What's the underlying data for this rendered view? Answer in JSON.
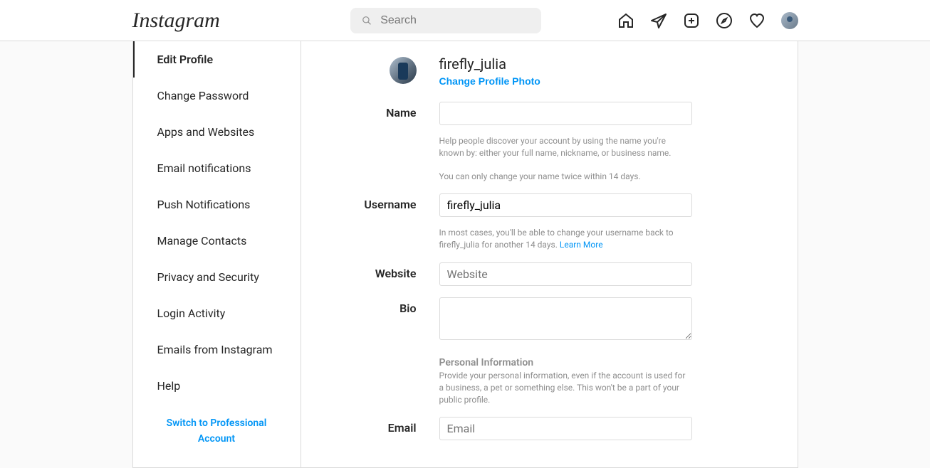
{
  "logo": "Instagram",
  "search": {
    "placeholder": "Search"
  },
  "sidebar": {
    "items": [
      "Edit Profile",
      "Change Password",
      "Apps and Websites",
      "Email notifications",
      "Push Notifications",
      "Manage Contacts",
      "Privacy and Security",
      "Login Activity",
      "Emails from Instagram",
      "Help"
    ],
    "switch": "Switch to Professional Account"
  },
  "profile": {
    "username_display": "firefly_julia",
    "change_photo": "Change Profile Photo"
  },
  "form": {
    "name_label": "Name",
    "name_value": "",
    "name_help1": "Help people discover your account by using the name you're known by: either your full name, nickname, or business name.",
    "name_help2": "You can only change your name twice within 14 days.",
    "username_label": "Username",
    "username_value": "firefly_julia",
    "username_help": "In most cases, you'll be able to change your username back to firefly_julia for another 14 days. ",
    "username_learn_more": "Learn More",
    "website_label": "Website",
    "website_placeholder": "Website",
    "website_value": "",
    "bio_label": "Bio",
    "bio_value": "",
    "personal_heading": "Personal Information",
    "personal_help": "Provide your personal information, even if the account is used for a business, a pet or something else. This won't be a part of your public profile.",
    "email_label": "Email",
    "email_placeholder": "Email",
    "email_value": ""
  }
}
